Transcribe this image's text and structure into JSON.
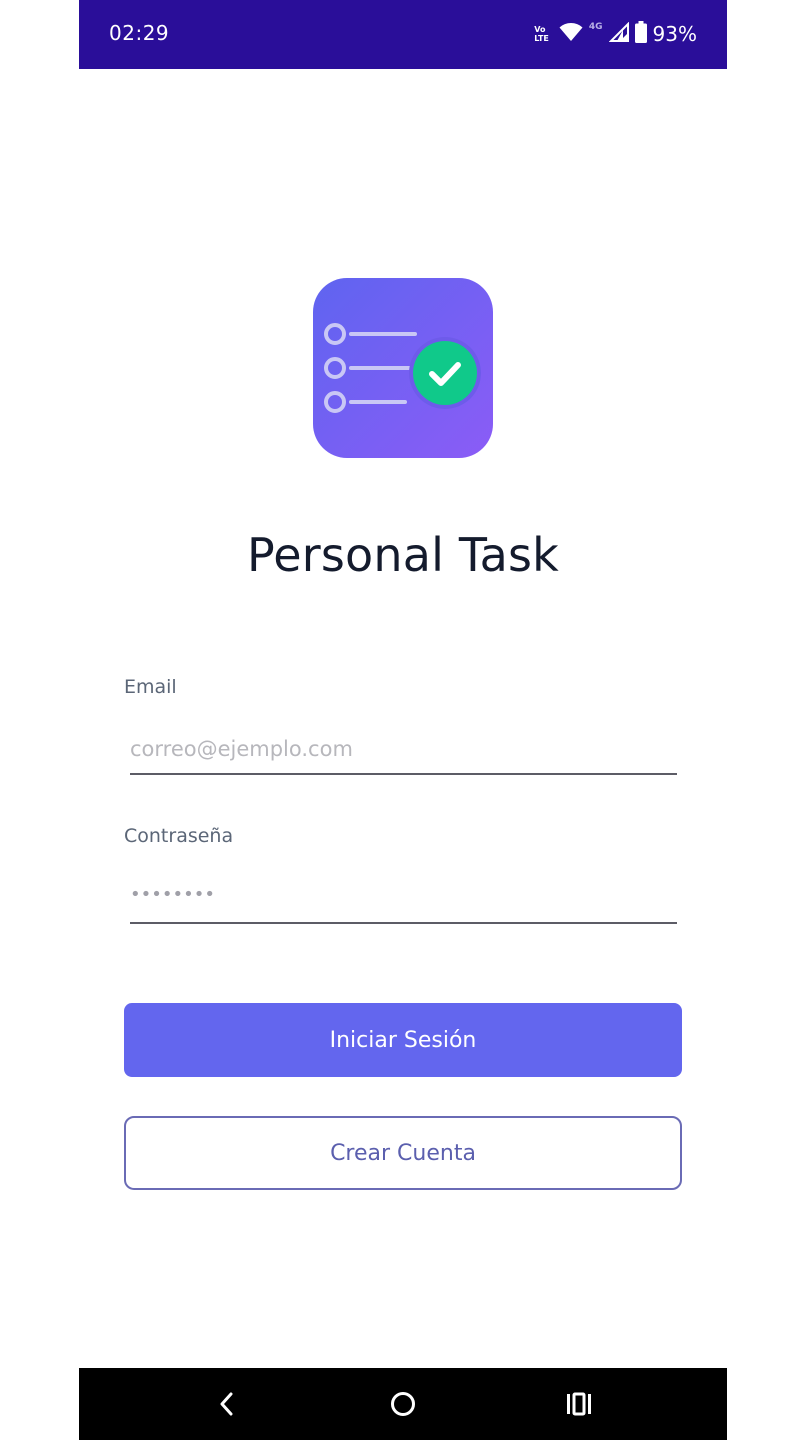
{
  "status_bar": {
    "time": "02:29",
    "volte_top": "Vo",
    "volte_bottom": "LTE",
    "network": "4G",
    "battery": "93%",
    "icons": [
      "volte-icon",
      "wifi-icon",
      "signal-icon",
      "battery-icon"
    ]
  },
  "app": {
    "title": "Personal Task",
    "logo_icon": "task-checklist-logo-icon",
    "colors": {
      "status_bar": "#2a0e99",
      "logo_gradient_start": "#5f64f0",
      "logo_gradient_end": "#8b5cf6",
      "check_badge": "#10c98a",
      "primary_button": "#6366ee",
      "outline_button": "#6a6bb5"
    }
  },
  "form": {
    "email_label": "Email",
    "email_placeholder": "correo@ejemplo.com",
    "password_label": "Contraseña",
    "password_value": "••••••••",
    "login_button": "Iniciar Sesión",
    "signup_button": "Crear Cuenta"
  },
  "nav": {
    "back_icon": "back-icon",
    "home_icon": "home-icon",
    "recents_icon": "recents-icon"
  }
}
